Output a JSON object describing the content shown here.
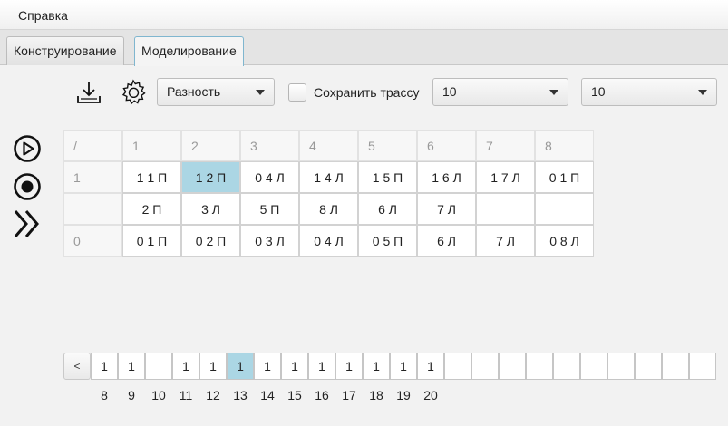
{
  "menu": {
    "help": "Справка"
  },
  "tabs": [
    {
      "label": "Конструирование",
      "active": false
    },
    {
      "label": "Моделирование",
      "active": true
    }
  ],
  "toolbar": {
    "download_icon": "download-tray-icon",
    "settings_icon": "gear-icon",
    "mode_select": "Разность",
    "save_trace_label": "Сохранить трассу",
    "save_trace_checked": false,
    "select_a": "10",
    "select_b": "10"
  },
  "side_controls": {
    "play_icon": "play-circle-icon",
    "stop_icon": "stop-circle-icon",
    "fast_forward_icon": "fast-forward-icon"
  },
  "table": {
    "corner": "/",
    "columns": [
      "1",
      "2",
      "3",
      "4",
      "5",
      "6",
      "7",
      "8"
    ],
    "rows": [
      {
        "label": "1",
        "cells": [
          "1 1 П",
          "1 2 П",
          "0 4 Л",
          "1 4 Л",
          "1 5 П",
          "1 6 Л",
          "1 7 Л",
          "0 1 П"
        ],
        "selected_index": 1
      },
      {
        "label": "",
        "cells": [
          "2 П",
          "3 Л",
          "5 П",
          "8 Л",
          "6 Л",
          "7 Л",
          "",
          ""
        ],
        "selected_index": -1
      },
      {
        "label": "0",
        "cells": [
          "0 1 П",
          "0 2 П",
          "0 3 Л",
          "0 4 Л",
          "0 5 П",
          "6 Л",
          "7 Л",
          "0 8 Л"
        ],
        "selected_index": -1
      }
    ]
  },
  "pager": {
    "prev": "<",
    "next": ">",
    "cells": [
      "1",
      "1",
      "",
      "1",
      "1",
      "1",
      "1",
      "1",
      "1",
      "1",
      "1",
      "1",
      "1",
      "",
      "",
      "",
      "",
      "",
      "",
      "",
      "",
      "",
      ""
    ],
    "labels": [
      "8",
      "9",
      "10",
      "11",
      "12",
      "13",
      "14",
      "15",
      "16",
      "17",
      "18",
      "19",
      "20"
    ],
    "selected_index": 5
  },
  "colors": {
    "selection": "#abd6e4",
    "background": "#f2f2f2",
    "tab_active_border": "#7fb6cf"
  }
}
